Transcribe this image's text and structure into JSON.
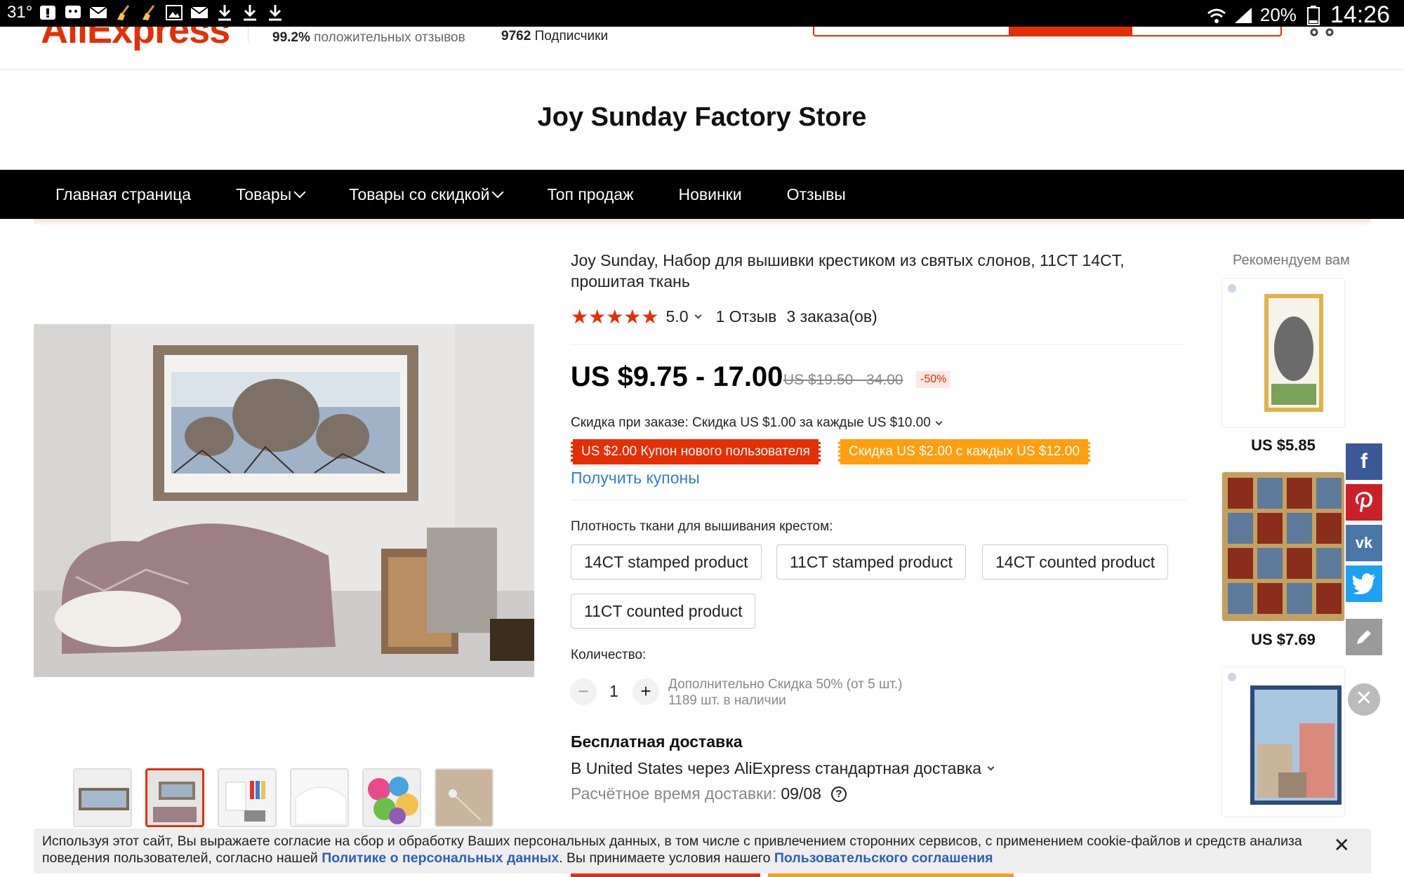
{
  "status_bar": {
    "temperature": "31°",
    "battery": "20%",
    "time": "14:26"
  },
  "header": {
    "logo_text": "AliExpress",
    "feedback_value": "99.2%",
    "feedback_label": "положительных отзывов",
    "followers_value": "9762",
    "followers_label": "Подписчики"
  },
  "store": {
    "title": "Joy Sunday Factory Store"
  },
  "nav": {
    "items": [
      {
        "label": "Главная страница"
      },
      {
        "label": "Товары"
      },
      {
        "label": "Товары со скидкой"
      },
      {
        "label": "Топ продаж"
      },
      {
        "label": "Новинки"
      },
      {
        "label": "Отзывы"
      }
    ]
  },
  "product": {
    "title": "Joy Sunday, Набор для вышивки крестиком из святых слонов, 11CT 14CT, прошитая ткань",
    "rating_value": "5.0",
    "reviews": "1 Отзыв",
    "orders": "3 заказа(ов)",
    "price": "US $9.75 - 17.00",
    "old_price": "US $19.50 - 34.00",
    "discount_badge": "-50%",
    "discount_line": "Скидка при заказе: Скидка US $1.00 за каждые US $10.00",
    "coupon_new_user": "US $2.00 Купон нового пользователя",
    "coupon_store": "Скидка US $2.00 с каждых US $12.00",
    "get_coupons": "Получить купоны",
    "density_label": "Плотность ткани для вышивания крестом:",
    "options": [
      "14CT stamped product",
      "11CT stamped product",
      "14CT counted product",
      "11CT counted product"
    ],
    "quantity_label": "Количество:",
    "quantity": "1",
    "qty_extra": "Дополнительно Скидка 50% (от 5 шт.)",
    "stock": "1189 шт. в наличии",
    "shipping_title": "Бесплатная доставка",
    "shipping_line": "В United States через AliExpress стандартная доставка",
    "eta_label": "Расчётное время доставки:",
    "eta_value": "09/08"
  },
  "recommended": {
    "title": "Рекомендуем вам",
    "items": [
      {
        "price": "US $5.85"
      },
      {
        "price": "US $7.69"
      }
    ]
  },
  "share": {
    "facebook": "f",
    "vk": "vk"
  },
  "cookie": {
    "text1": "Используя этот сайт, Вы выражаете согласие на сбор и обработку Ваших персональных данных, в том числе с привлечением сторонних сервисов, с применением cookie-файлов и средств анализа поведения пользователей, согласно нашей",
    "link1": "Политике о персональных данных",
    "text2": ". Вы принимаете условия нашего",
    "link2": "Пользовательского соглашения",
    "close": "✕"
  },
  "colors": {
    "accent": "#e62e04",
    "orange": "#ff9e0f",
    "link": "#2f80c9",
    "nav_bg": "#000000",
    "facebook": "#3b5998",
    "pinterest": "#cb2027",
    "vk": "#4a76a8",
    "twitter": "#1da1f2"
  }
}
